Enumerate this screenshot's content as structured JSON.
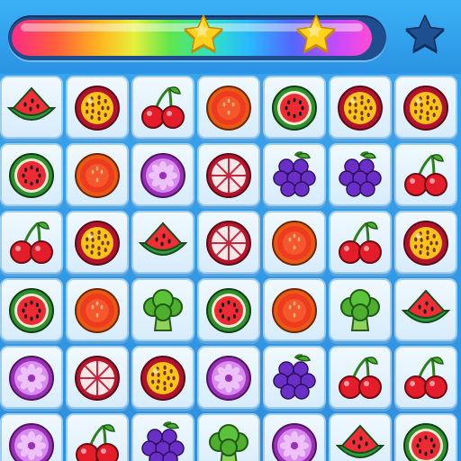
{
  "progress": {
    "fill_fraction": 0.97
  },
  "stars": [
    {
      "name": "star-1",
      "earned": true
    },
    {
      "name": "star-2",
      "earned": true
    },
    {
      "name": "star-3",
      "earned": false
    }
  ],
  "colors": {
    "earned_star": "#ffd21e",
    "unearned_star": "#1d4f91",
    "tile_face": "#eaf6ff",
    "tile_border": "#9dcdf1"
  },
  "board": {
    "columns": 7,
    "rows": [
      [
        "watermelon-slice",
        "passion-fruit",
        "cherries",
        "blood-orange",
        "kiwi-melon",
        "passion-fruit",
        "passion-fruit"
      ],
      [
        "kiwi-melon",
        "blood-orange",
        "dragon-fruit",
        "grapefruit",
        "grapes",
        "grapes",
        "cherries"
      ],
      [
        "cherries",
        "passion-fruit",
        "watermelon-slice",
        "grapefruit",
        "blood-orange",
        "cherries",
        "passion-fruit"
      ],
      [
        "kiwi-melon",
        "blood-orange",
        "broccoli",
        "kiwi-melon",
        "blood-orange",
        "broccoli",
        "watermelon-slice"
      ],
      [
        "dragon-fruit",
        "grapefruit",
        "passion-fruit",
        "dragon-fruit",
        "grapes",
        "cherries",
        "cherries"
      ],
      [
        "dragon-fruit",
        "cherries",
        "grapes",
        "broccoli",
        "dragon-fruit",
        "watermelon-slice",
        "kiwi-melon"
      ]
    ]
  }
}
